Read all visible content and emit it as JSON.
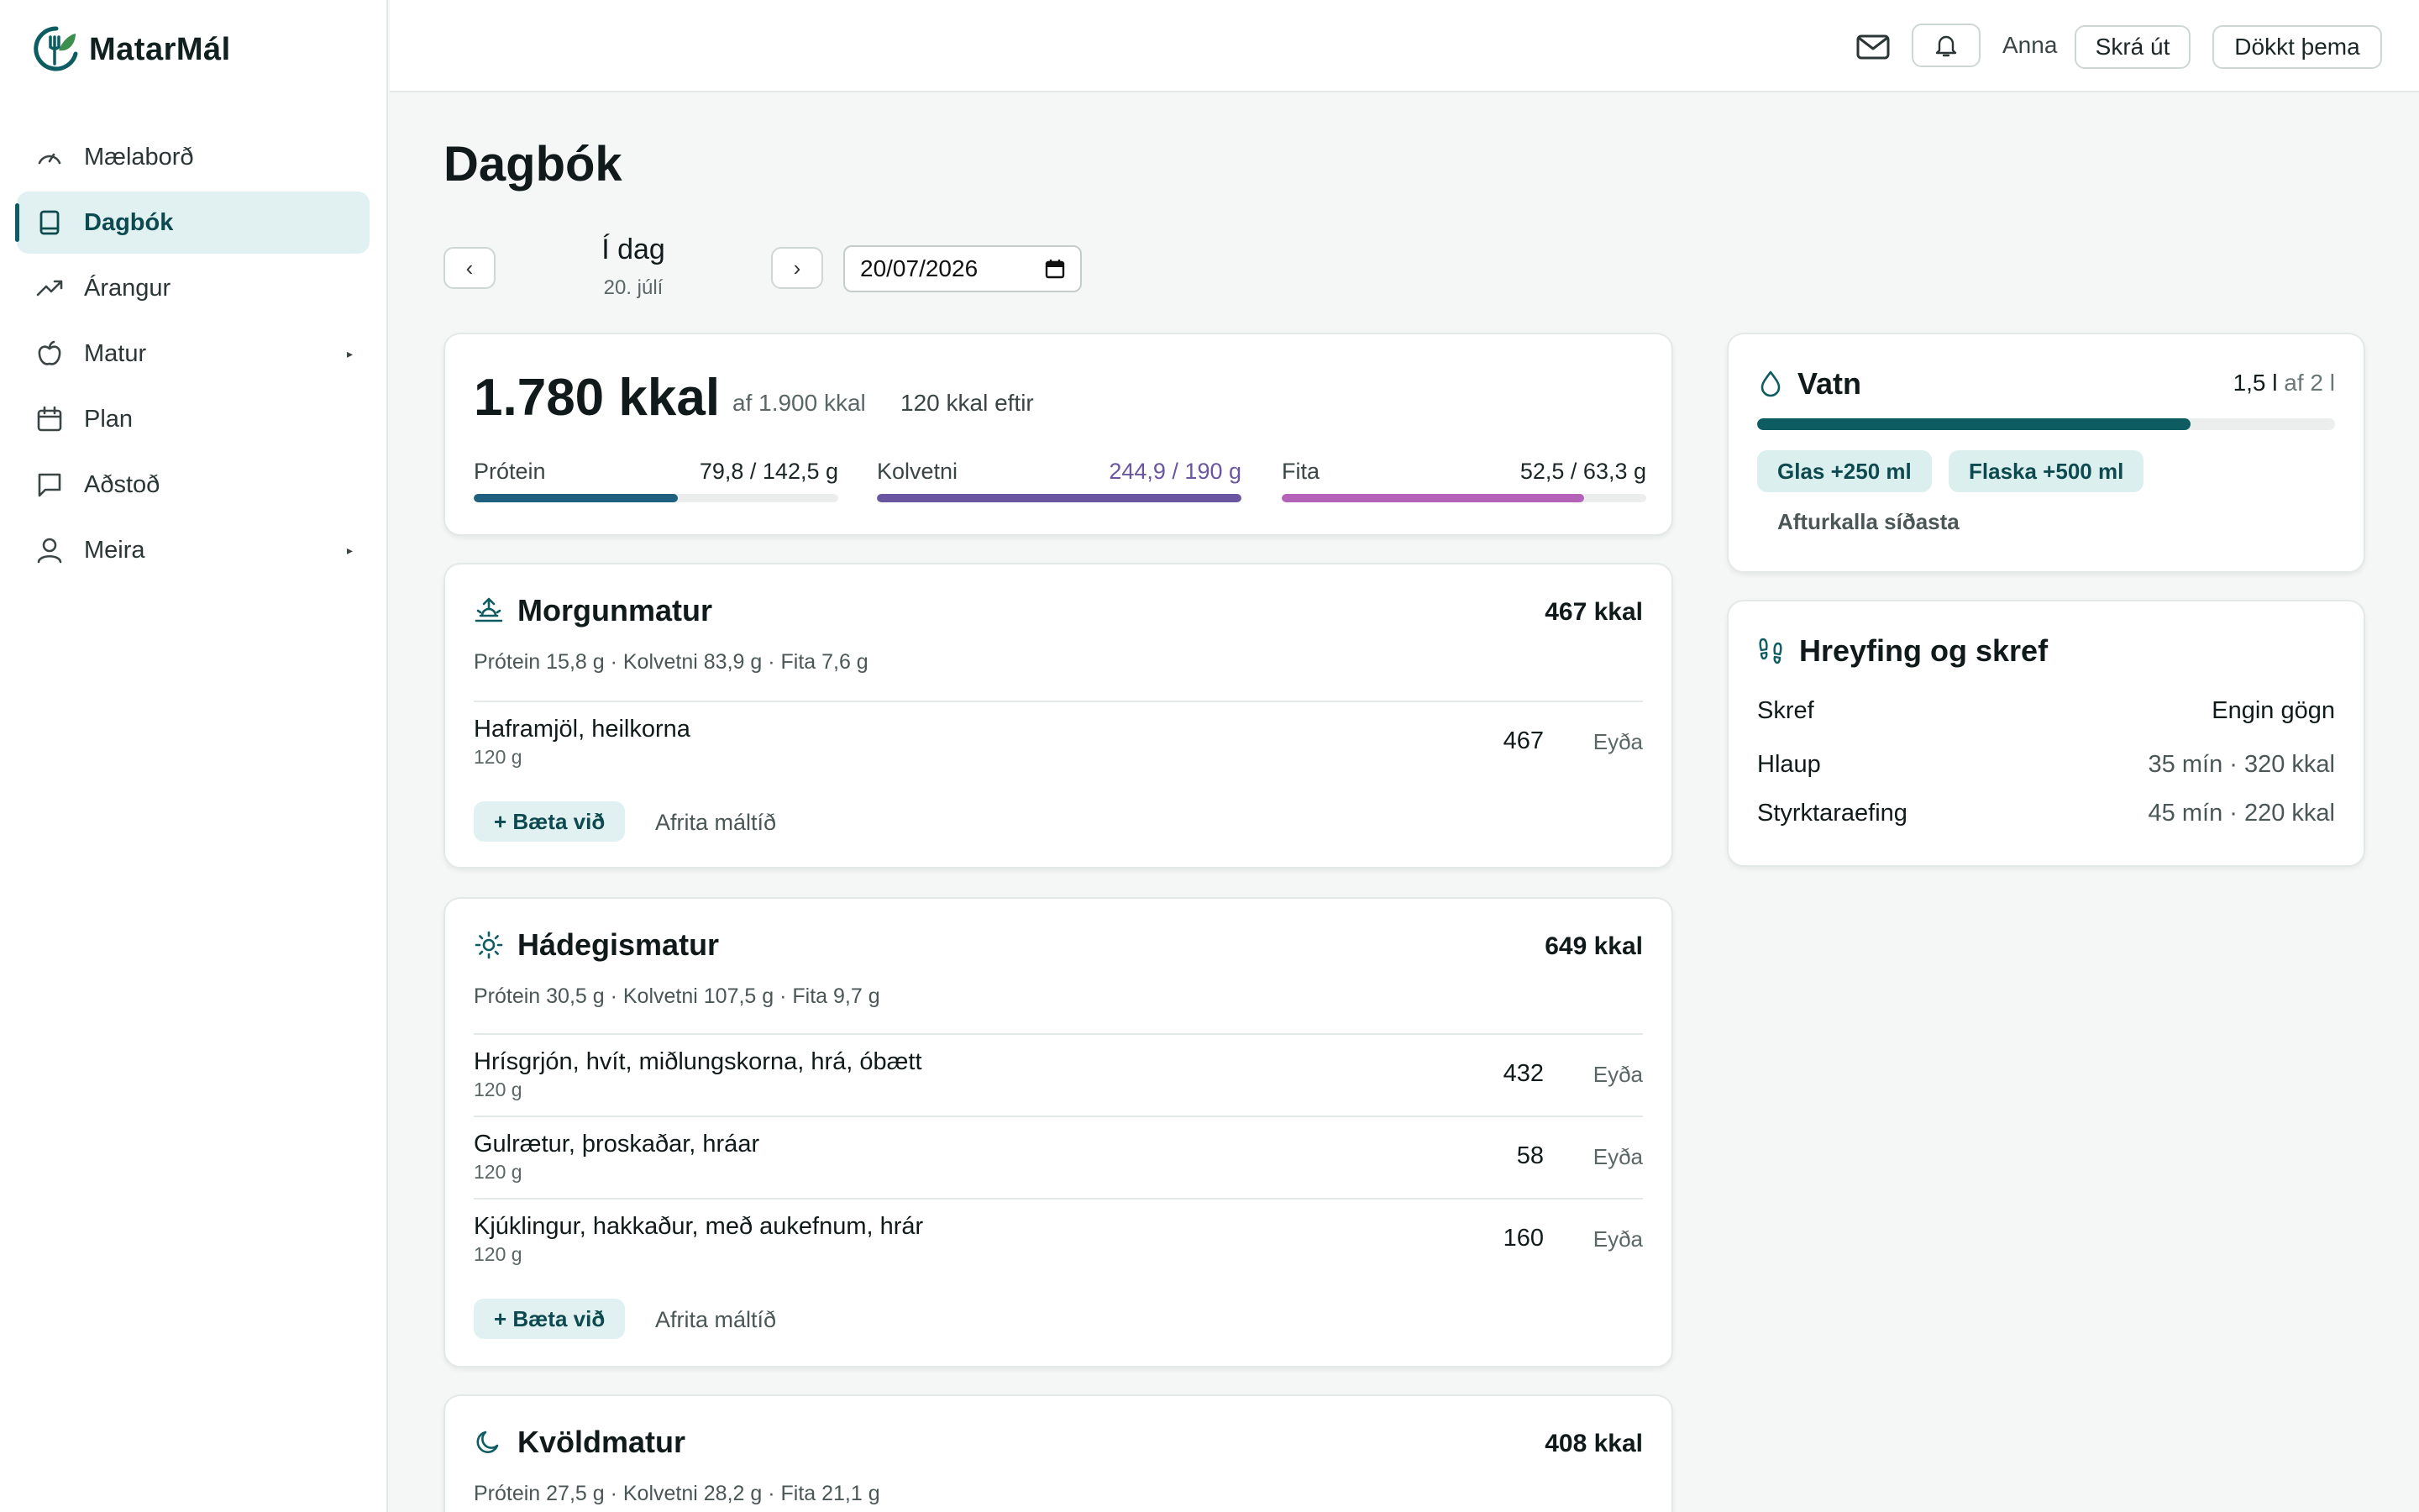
{
  "app": {
    "name": "MatarMál"
  },
  "sidebar": {
    "items": [
      {
        "label": "Mælaborð",
        "icon": "gauge-icon"
      },
      {
        "label": "Dagbók",
        "icon": "book-icon",
        "active": true
      },
      {
        "label": "Árangur",
        "icon": "trending-up-icon"
      },
      {
        "label": "Matur",
        "icon": "apple-icon",
        "has_submenu": true
      },
      {
        "label": "Plan",
        "icon": "calendar-icon"
      },
      {
        "label": "Aðstoð",
        "icon": "message-icon"
      },
      {
        "label": "Meira",
        "icon": "user-icon",
        "has_submenu": true
      }
    ],
    "caret": "▸"
  },
  "topbar": {
    "user": "Anna",
    "logout_label": "Skrá út",
    "theme_label": "Dökkt þema"
  },
  "page": {
    "title": "Dagbók"
  },
  "date_nav": {
    "prev": "‹",
    "next": "›",
    "day_label": "Í dag",
    "date_label": "20. júlí",
    "date_value": "20/07/2026"
  },
  "summary": {
    "kcal": "1.780 kkal",
    "goal": "af 1.900 kkal",
    "remaining": "120 kkal eftir",
    "macros": [
      {
        "label": "Prótein",
        "value": "79,8 / 142,5 g",
        "fraction": 0.56,
        "color": "#1f5f7f",
        "value_color": "#1c2626"
      },
      {
        "label": "Kolvetni",
        "value": "244,9 / 190 g",
        "fraction": 1.0,
        "color": "#6a56a0",
        "value_color": "#6a56a0"
      },
      {
        "label": "Fita",
        "value": "52,5 / 63,3 g",
        "fraction": 0.83,
        "color": "#b463b8",
        "value_color": "#1c2626"
      }
    ]
  },
  "meals": [
    {
      "title": "Morgunmatur",
      "icon": "sunrise-icon",
      "kcal": "467 kkal",
      "macros": "Prótein 15,8 g · Kolvetni 83,9 g · Fita 7,6 g",
      "foods": [
        {
          "name": "Haframjöl, heilkorna",
          "qty": "120 g",
          "kcal": "467",
          "delete": "Eyða"
        }
      ],
      "add": "+ Bæta við",
      "copy": "Afrita máltíð"
    },
    {
      "title": "Hádegismatur",
      "icon": "sun-icon",
      "kcal": "649 kkal",
      "macros": "Prótein 30,5 g · Kolvetni 107,5 g · Fita 9,7 g",
      "foods": [
        {
          "name": "Hrísgrjón, hvít, miðlungskorna, hrá, óbætt",
          "qty": "120 g",
          "kcal": "432",
          "delete": "Eyða"
        },
        {
          "name": "Gulrætur, þroskaðar, hráar",
          "qty": "120 g",
          "kcal": "58",
          "delete": "Eyða"
        },
        {
          "name": "Kjúklingur, hakkaður, með aukefnum, hrár",
          "qty": "120 g",
          "kcal": "160",
          "delete": "Eyða"
        }
      ],
      "add": "+ Bæta við",
      "copy": "Afrita máltíð"
    },
    {
      "title": "Kvöldmatur",
      "icon": "moon-icon",
      "kcal": "408 kkal",
      "macros": "Prótein 27,5 g · Kolvetni 28,2 g · Fita 21,1 g"
    }
  ],
  "water": {
    "title": "Vatn",
    "amount": "1,5 l",
    "of": "af 2 l",
    "fraction": 0.75,
    "chip_glass": "Glas +250 ml",
    "chip_bottle": "Flaska +500 ml",
    "undo": "Afturkalla síðasta"
  },
  "activity": {
    "title": "Hreyfing og skref",
    "rows": [
      {
        "label": "Skref",
        "value": "Engin gögn"
      },
      {
        "label": "Hlaup",
        "value": "35 mín · 320 kkal"
      },
      {
        "label": "Styrktaraefing",
        "value": "45 mín · 220 kkal"
      }
    ]
  }
}
